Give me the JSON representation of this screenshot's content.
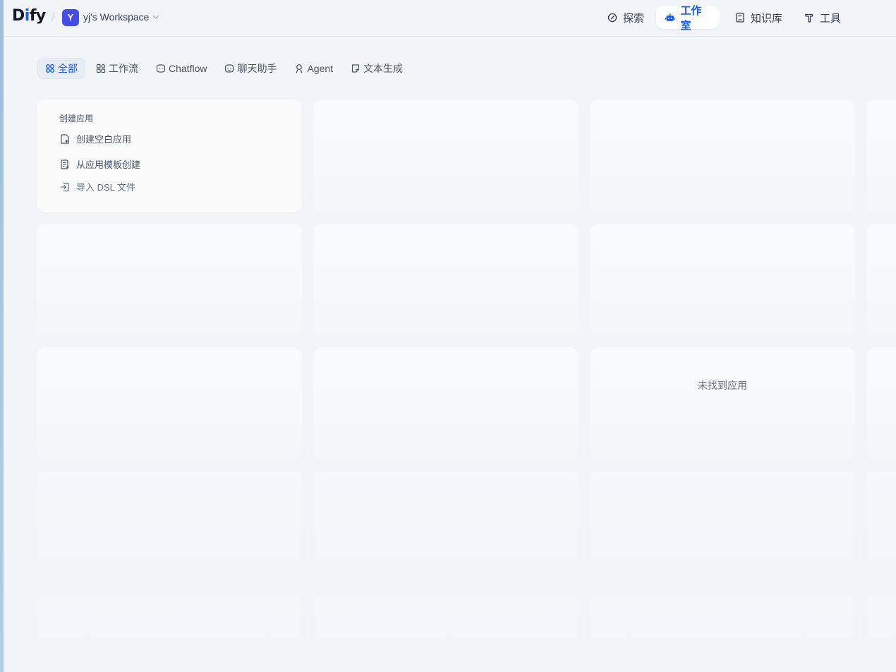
{
  "header": {
    "logo_prefix": "D",
    "logo_highlight": "i",
    "logo_suffix": "fy",
    "workspace_initial": "Y",
    "workspace_name": "yj's Workspace",
    "nav": {
      "explore": "探索",
      "studio": "工作室",
      "knowledge": "知识库",
      "tools": "工具"
    }
  },
  "tabs": {
    "all": "全部",
    "workflow": "工作流",
    "chatflow": "Chatflow",
    "chat_assistant": "聊天助手",
    "agent": "Agent",
    "text_generation": "文本生成"
  },
  "create_card": {
    "title": "创建应用",
    "blank": "创建空白应用",
    "from_template": "从应用模板创建",
    "import_dsl": "导入 DSL 文件"
  },
  "empty_state": "未找到应用",
  "colors": {
    "accent": "#155aef",
    "avatar": "#444ce7",
    "background": "#f2f4f7"
  }
}
